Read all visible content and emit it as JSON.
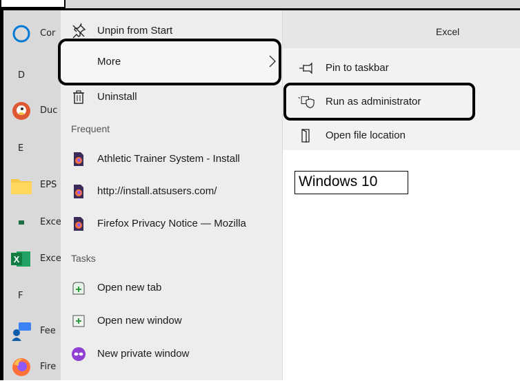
{
  "start_menu": {
    "tile_label": "Excel",
    "app_list": [
      {
        "type": "app",
        "text": "Cor",
        "icon": "cortana-icon"
      },
      {
        "type": "letter",
        "text": "D"
      },
      {
        "type": "app",
        "text": "Duc",
        "icon": "duckduckgo-icon"
      },
      {
        "type": "letter",
        "text": "E"
      },
      {
        "type": "app",
        "text": "EPS",
        "icon": "folder-icon"
      },
      {
        "type": "app",
        "text": "Exce",
        "icon": "excel-small-icon"
      },
      {
        "type": "app",
        "text": "Exce",
        "icon": "excel-icon"
      },
      {
        "type": "letter",
        "text": "F"
      },
      {
        "type": "app",
        "text": "Fee",
        "icon": "feedback-hub-icon"
      },
      {
        "type": "app",
        "text": "Fire",
        "icon": "firefox-icon"
      }
    ]
  },
  "context_menu": {
    "items": [
      {
        "label": "Unpin from Start",
        "icon": "unpin-icon"
      },
      {
        "label": "More",
        "icon": "chevron-right-icon"
      },
      {
        "label": "Uninstall",
        "icon": "trash-icon"
      }
    ],
    "frequent_heading": "Frequent",
    "frequent": [
      {
        "label": "Athletic Trainer System - Install",
        "icon": "firefox-doc-icon"
      },
      {
        "label": "http://install.atsusers.com/",
        "icon": "firefox-doc-icon"
      },
      {
        "label": "Firefox Privacy Notice — Mozilla",
        "icon": "firefox-doc-icon"
      }
    ],
    "tasks_heading": "Tasks",
    "tasks": [
      {
        "label": "Open new tab",
        "icon": "new-tab-icon"
      },
      {
        "label": "Open new window",
        "icon": "new-window-icon"
      },
      {
        "label": "New private window",
        "icon": "private-window-icon"
      }
    ]
  },
  "submenu": {
    "items": [
      {
        "label": "Pin to taskbar",
        "icon": "pin-icon"
      },
      {
        "label": "Run as administrator",
        "icon": "admin-shield-icon"
      },
      {
        "label": "Open file location",
        "icon": "file-location-icon"
      }
    ]
  },
  "annotation": {
    "label": "Windows 10"
  },
  "colors": {
    "menu_bg": "#ededed",
    "submenu_bg": "#f2f2f2",
    "excel_green": "#1d6f42",
    "firefox_orange": "#ff7139",
    "cortana_blue": "#0078d4"
  }
}
